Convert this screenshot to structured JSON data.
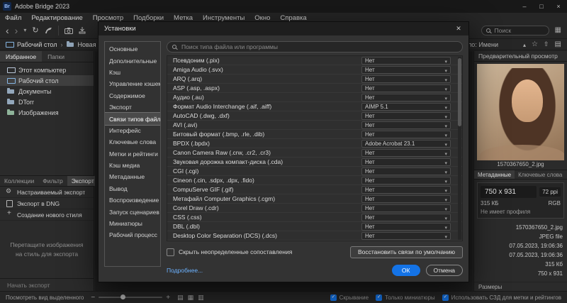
{
  "window": {
    "title": "Adobe Bridge 2023",
    "app_initials": "Br",
    "minimize_glyph": "–",
    "maximize_glyph": "□",
    "close_glyph": "×"
  },
  "menu": {
    "items": [
      "Файл",
      "Редактирование",
      "Просмотр",
      "Подборки",
      "Метка",
      "Инструменты",
      "Окно",
      "Справка"
    ]
  },
  "toolbar": {
    "search_placeholder": "Поиск"
  },
  "pathbar": {
    "crumbs": [
      "Рабочий стол",
      "Новая папка"
    ],
    "separator": "›",
    "sort_label": "Сорт. по: Имени"
  },
  "left_panel": {
    "tabs": [
      "Избранное",
      "Папки"
    ],
    "tabs_selected_index": 0,
    "favorites": [
      {
        "label": "Этот компьютер",
        "icon": "computer"
      },
      {
        "label": "Рабочий стол",
        "icon": "desktop"
      },
      {
        "label": "Документы",
        "icon": "folder"
      },
      {
        "label": "DTorr",
        "icon": "folder"
      },
      {
        "label": "Изображения",
        "icon": "images"
      }
    ],
    "favorites_selected_index": 1,
    "bottom_tabs": [
      "Коллекции",
      "Фильтр",
      "Экспорт"
    ],
    "bottom_tabs_selected_index": 2,
    "export_items": [
      {
        "label": "Настраиваемый экспорт",
        "icon": "gear"
      },
      {
        "label": "Экспорт в DNG",
        "icon": "dng"
      },
      {
        "label": "Создание нового стиля",
        "icon": "plus"
      }
    ],
    "dropzone_text": "Перетащите изображения на стиль для экспорта",
    "start_export_label": "Начать экспорт"
  },
  "right_panel": {
    "panel_tab": "Предварительный просмотр",
    "filename": "1570367650_2.jpg",
    "tabs": [
      "Метаданные",
      "Ключевые слова"
    ],
    "tabs_selected_index": 0,
    "placard": {
      "dimensions": "750 x 931",
      "size": "315 КБ",
      "resolution": "72 ppi",
      "color_mode": "RGB",
      "profile": "Не имеет профиля"
    },
    "details": [
      "1570367650_2.jpg",
      "JPEG file",
      "07.05.2023, 19:06:36",
      "07.05.2023, 19:06:36",
      "315 Кб",
      "750 x 931"
    ],
    "details_footer": "Размеры"
  },
  "dialog": {
    "title": "Установки",
    "close_glyph": "✕",
    "nav": [
      "Основные",
      "Дополнительные",
      "Кэш",
      "Управление кэшем",
      "Содержимое",
      "Экспорт",
      "Связи типов файлов",
      "Интерфейс",
      "Ключевые слова",
      "Метки и рейтинги",
      "Кэш медиа",
      "Метаданные",
      "Вывод",
      "Воспроизведение",
      "Запуск сценариев",
      "Миниатюры",
      "Рабочий процесс"
    ],
    "nav_selected_index": 6,
    "search_placeholder": "Поиск типа файла или программы",
    "associations": [
      {
        "label": "Псевдоним (.pix)",
        "value": "Нет"
      },
      {
        "label": "Amiga Audio (.svx)",
        "value": "Нет"
      },
      {
        "label": "ARQ (.arq)",
        "value": "Нет"
      },
      {
        "label": "ASP (.asp, .aspx)",
        "value": "Нет"
      },
      {
        "label": "Аудио (.au)",
        "value": "Нет"
      },
      {
        "label": "Формат Audio Interchange (.aif, .aiff)",
        "value": "AIMP 5.1"
      },
      {
        "label": "AutoCAD (.dwg, .dxf)",
        "value": "Нет"
      },
      {
        "label": "AVI (.avi)",
        "value": "Нет"
      },
      {
        "label": "Битовый формат (.bmp, .rle, .dib)",
        "value": "Нет"
      },
      {
        "label": "BPDX (.bpdx)",
        "value": "Adobe Acrobat 23.1"
      },
      {
        "label": "Canon Camera Raw (.crw, .cr2, .cr3)",
        "value": "Нет"
      },
      {
        "label": "Звуковая дорожка компакт-диска (.cda)",
        "value": "Нет"
      },
      {
        "label": "CGI (.cgi)",
        "value": "Нет"
      },
      {
        "label": "Cineon (.cin, .sdpx, .dpx, .fido)",
        "value": "Нет"
      },
      {
        "label": "CompuServe GIF (.gif)",
        "value": "Нет"
      },
      {
        "label": "Метафайл Computer Graphics (.cgm)",
        "value": "Нет"
      },
      {
        "label": "Corel Draw (.cdr)",
        "value": "Нет"
      },
      {
        "label": "CSS (.css)",
        "value": "Нет"
      },
      {
        "label": "DBL (.dbl)",
        "value": "Нет"
      },
      {
        "label": "Desktop Color Separation (DCS) (.dcs)",
        "value": "Нет"
      }
    ],
    "hide_checkbox_label": "Скрыть неопределенные сопоставления",
    "restore_button_label": "Восстановить связи по умолчанию",
    "more_link": "Подробнее...",
    "ok_label": "ОК",
    "cancel_label": "Отмена"
  },
  "statusbar": {
    "left_text": "Посмотреть вид выделенного",
    "options": [
      "Скрывание",
      "Только миниатюры",
      "Использовать СЗД для метки и рейтингов"
    ]
  },
  "colors": {
    "accent_blue": "#1473e6"
  }
}
